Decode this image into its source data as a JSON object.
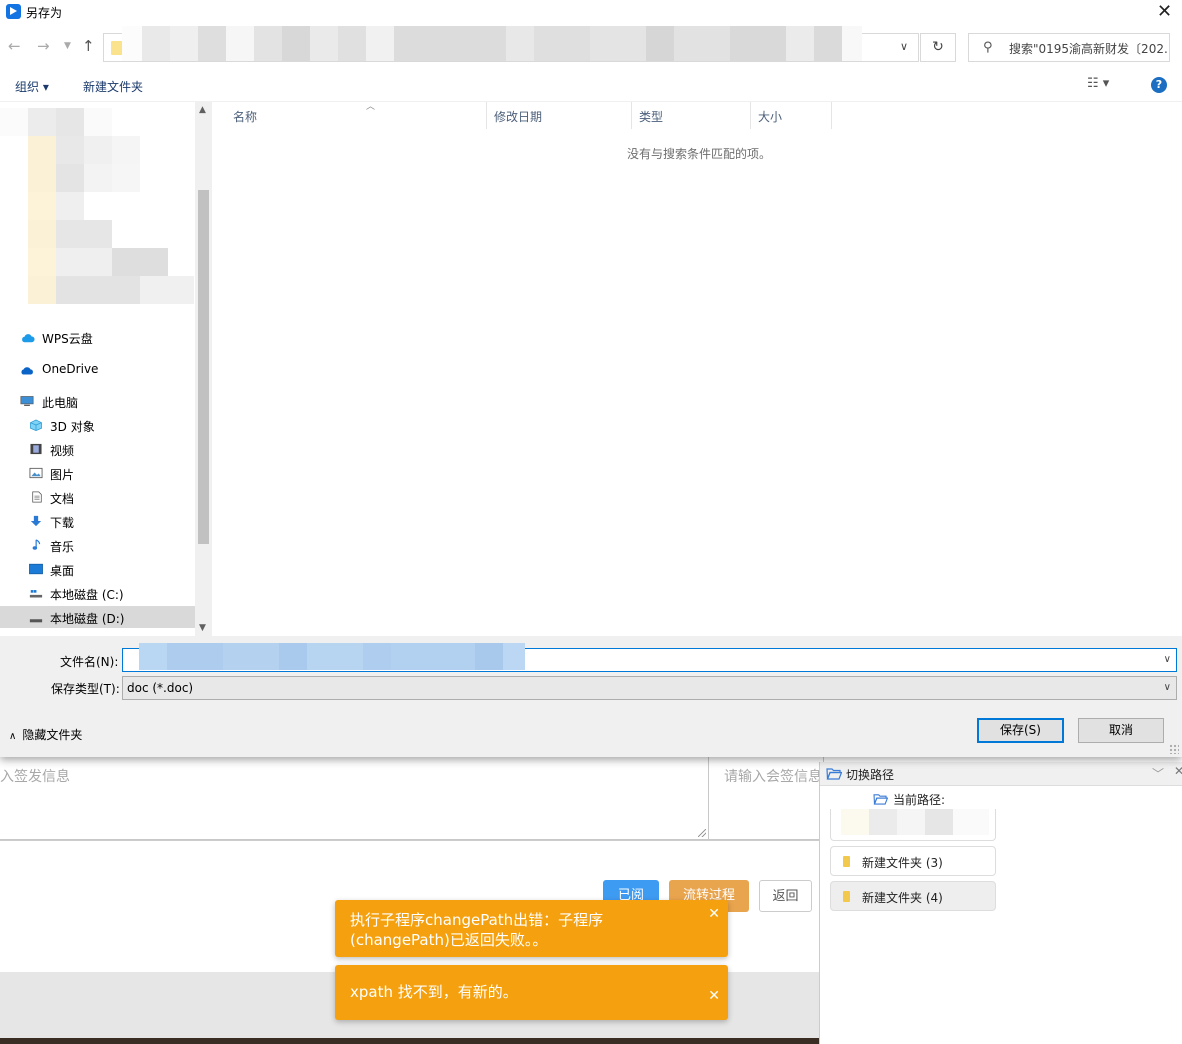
{
  "dialog": {
    "title": "另存为",
    "search_placeholder": "搜索\"0195渝高新财发〔202...",
    "toolbar": {
      "organize": "组织 ▾",
      "new_folder": "新建文件夹"
    },
    "nav": {
      "wps": "WPS云盘",
      "onedrive": "OneDrive",
      "this_pc": "此电脑",
      "items": [
        "3D 对象",
        "视频",
        "图片",
        "文档",
        "下载",
        "音乐",
        "桌面",
        "本地磁盘 (C:)",
        "本地磁盘 (D:)"
      ]
    },
    "columns": [
      "名称",
      "修改日期",
      "类型",
      "大小"
    ],
    "empty_message": "没有与搜索条件匹配的项。",
    "filename_label": "文件名(N):",
    "filetype_label": "保存类型(T):",
    "filetype_value": "doc (*.doc)",
    "hide_folders": "隐藏文件夹",
    "save_button": "保存(S)",
    "cancel_button": "取消"
  },
  "page": {
    "sign_placeholder": "输入签发信息",
    "cosign_placeholder": "请输入会签信息",
    "buttons": {
      "read": "已阅",
      "flow": "流转过程",
      "back": "返回"
    },
    "path_panel": {
      "title": "切换路径",
      "current_path_label": "当前路径:",
      "folders": [
        "新建文件夹 (3)",
        "新建文件夹 (4)"
      ]
    }
  },
  "toasts": [
    {
      "message": "执行子程序changePath出错：子程序(changePath)已返回失败。。"
    },
    {
      "message": "xpath 找不到，有新的。"
    }
  ],
  "colors": {
    "accent": "#0078d7",
    "toast": "#f5a10f",
    "read_button": "#3e9bf2",
    "flow_button": "#e9a44e"
  }
}
